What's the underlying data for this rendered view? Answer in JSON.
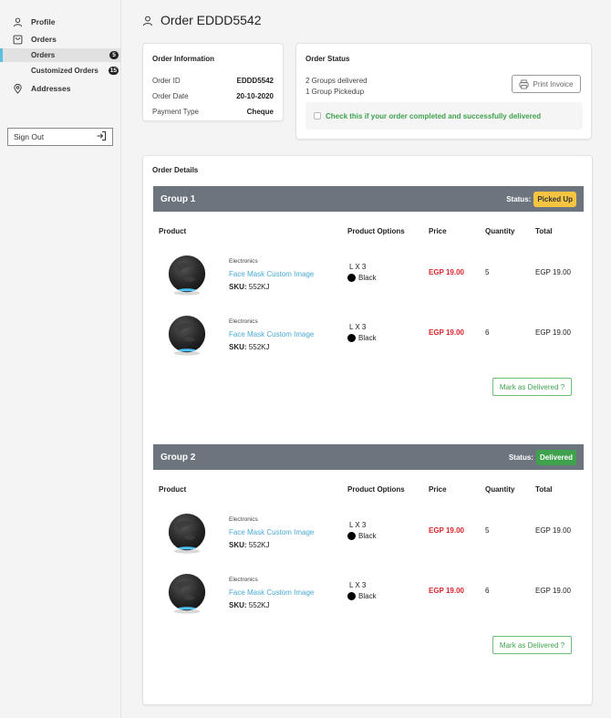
{
  "sidebar": {
    "profile": "Profile",
    "orders": "Orders",
    "orders_sub": "Orders",
    "orders_badge": "5",
    "customized_orders": "Customized Orders",
    "customized_badge": "15",
    "addresses": "Addresses",
    "sign_out": "Sign Out"
  },
  "header": {
    "title": "Order EDDD5542"
  },
  "order_info": {
    "title": "Order Information",
    "rows": [
      {
        "label": "Order ID",
        "value": "EDDD5542"
      },
      {
        "label": "Order Date",
        "value": "20-10-2020"
      },
      {
        "label": "Payment Type",
        "value": "Cheque"
      }
    ]
  },
  "order_status": {
    "title": "Order Status",
    "line1": "2 Groups delivered",
    "line2": "1 Group Pickedup",
    "print_label": "Print Invoice",
    "confirm_label": "Check this if your order completed and successfully delivered"
  },
  "details": {
    "title": "Order Details",
    "columns": {
      "product": "Product",
      "options": "Product Options",
      "price": "Price",
      "quantity": "Quantity",
      "total": "Total"
    },
    "status_label": "Status:",
    "mark_label": "Mark as Delivered ?",
    "groups": [
      {
        "name": "Group 1",
        "status": "Picked Up",
        "items": [
          {
            "category": "Electronics",
            "name": "Face Mask Custom Image",
            "sku_label": "SKU:",
            "sku": "552KJ",
            "size": "L X 3",
            "color": "Black",
            "price": "EGP 19.00",
            "quantity": "5",
            "total": "EGP 19.00"
          },
          {
            "category": "Electronics",
            "name": "Face Mask Custom Image",
            "sku_label": "SKU:",
            "sku": "552KJ",
            "size": "L X 3",
            "color": "Black",
            "price": "EGP 19.00",
            "quantity": "6",
            "total": "EGP 19.00"
          }
        ]
      },
      {
        "name": "Group 2",
        "status": "Delivered",
        "items": [
          {
            "category": "Electronics",
            "name": "Face Mask Custom Image",
            "sku_label": "SKU:",
            "sku": "552KJ",
            "size": "L X 3",
            "color": "Black",
            "price": "EGP 19.00",
            "quantity": "5",
            "total": "EGP 19.00"
          },
          {
            "category": "Electronics",
            "name": "Face Mask Custom Image",
            "sku_label": "SKU:",
            "sku": "552KJ",
            "size": "L X 3",
            "color": "Black",
            "price": "EGP 19.00",
            "quantity": "6",
            "total": "EGP 19.00"
          }
        ]
      }
    ]
  },
  "icons": {
    "profile": "user-icon",
    "orders": "shopping-bag-icon",
    "addresses": "map-pin-icon",
    "sign_out": "sign-out-icon",
    "print": "printer-icon"
  },
  "colors": {
    "accent": "#5bc0de",
    "link": "#4aa9d6",
    "price": "#d9262c",
    "success": "#3fa34d",
    "warning": "#f5c542",
    "group_header": "#6c757d"
  }
}
